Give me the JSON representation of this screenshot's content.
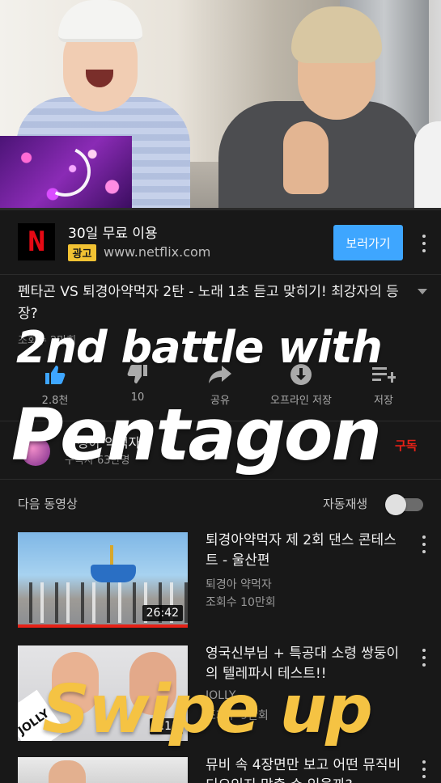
{
  "ad": {
    "title": "30일 무료 이용",
    "badge": "광고",
    "url": "www.netflix.com",
    "cta": "보러가기",
    "logo_letter": "N"
  },
  "video": {
    "title": "펜타곤 VS 퇴경아약먹자 2탄 - 노래 1초 듣고 맞히기! 최강자의 등장?",
    "views": "조회수 2만회"
  },
  "actions": [
    {
      "icon": "thumbs-up-icon",
      "label": "2.8천"
    },
    {
      "icon": "thumbs-down-icon",
      "label": "10"
    },
    {
      "icon": "share-icon",
      "label": "공유"
    },
    {
      "icon": "download-icon",
      "label": "오프라인 저장"
    },
    {
      "icon": "add-to-playlist-icon",
      "label": "저장"
    }
  ],
  "channel": {
    "name": "퇴경아 약먹자",
    "subscribers": "구독자 63만명",
    "subscribe": "구독"
  },
  "up_next": {
    "label": "다음 동영상",
    "autoplay_label": "자동재생",
    "autoplay_on": false
  },
  "recommended": [
    {
      "title": "퇴경아약먹자 제 2회 댄스 콘테스트 - 울산편",
      "channel": "퇴경아 약먹자",
      "views": "조회수 10만회",
      "duration": "26:42"
    },
    {
      "title": "영국신부님 + 특공대 소령 쌍둥이의 텔레파시 테스트!!",
      "channel": "JOLLY",
      "views": "조회수 9만회",
      "duration": "2:11",
      "thumb_badge": "JOLLY"
    },
    {
      "title": "뮤비 속 4장면만 보고 어떤 뮤직비디오인지 맞출 수 있을까?",
      "channel": "",
      "views": ""
    }
  ],
  "overlays": {
    "line1": "2nd battle with",
    "line2": "Pentagon",
    "line3": "Swipe up"
  },
  "colors": {
    "background": "#181818",
    "accent_blue": "#3ea6ff",
    "subscribe_red": "#e62117",
    "swipe_yellow": "#f5c343"
  }
}
